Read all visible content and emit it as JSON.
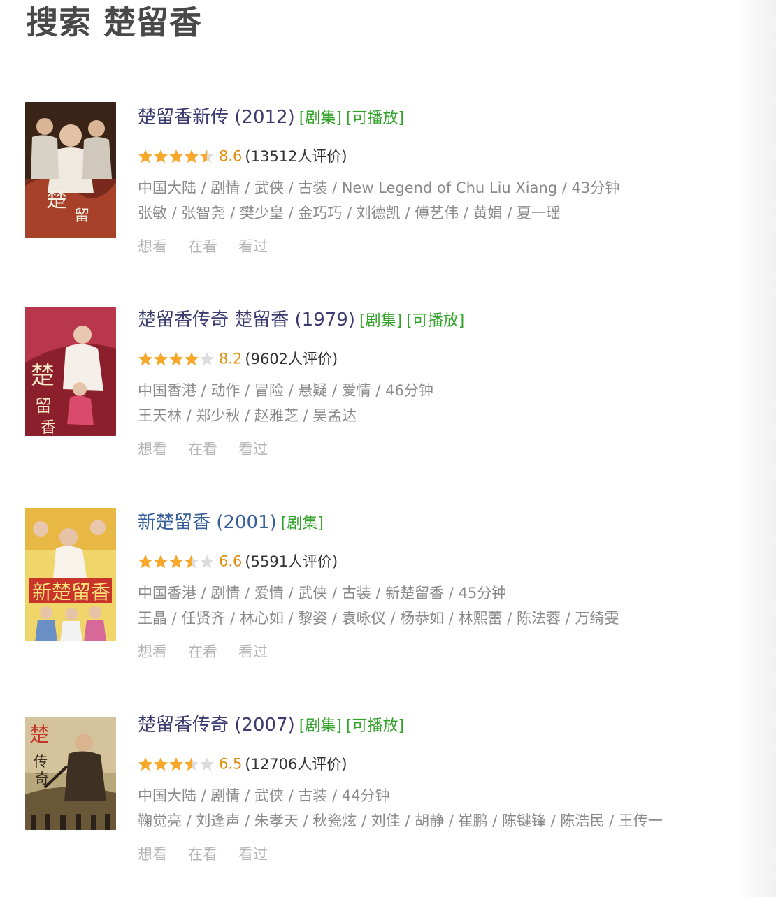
{
  "page_title": "搜索 楚留香",
  "colors": {
    "title": "#3b3b70",
    "tag": "#34a32b",
    "score": "#e09015",
    "star_on": "#f7a82a",
    "star_off": "#dcdcdc",
    "meta": "#8a8a8a"
  },
  "results": [
    {
      "title": "楚留香新传",
      "year": "(2012)",
      "tags": [
        "[剧集]",
        "[可播放]"
      ],
      "stars": 4.5,
      "score": "8.6",
      "votes": "(13512人评价)",
      "abstract": "中国大陆 / 剧情 / 武侠 / 古装 / New Legend of Chu Liu Xiang / 43分钟",
      "cast": "张敏 / 张智尧 / 樊少皇 / 金巧巧 / 刘德凯 / 傅艺伟 / 黄娟 / 夏一瑶",
      "actions": [
        "想看",
        "在看",
        "看过"
      ],
      "poster_icon": "poster-image"
    },
    {
      "title": "楚留香传奇 楚留香",
      "year": "(1979)",
      "tags": [
        "[剧集]",
        "[可播放]"
      ],
      "stars": 4,
      "score": "8.2",
      "votes": "(9602人评价)",
      "abstract": "中国香港 / 动作 / 冒险 / 悬疑 / 爱情 / 46分钟",
      "cast": "王天林 / 郑少秋 / 赵雅芝 / 吴孟达",
      "actions": [
        "想看",
        "在看",
        "看过"
      ],
      "poster_icon": "poster-image"
    },
    {
      "title": "新楚留香",
      "year": "(2001)",
      "tags": [
        "[剧集]"
      ],
      "stars": 3.5,
      "score": "6.6",
      "votes": "(5591人评价)",
      "abstract": "中国香港 / 剧情 / 爱情 / 武侠 / 古装 / 新楚留香 / 45分钟",
      "cast": "王晶 / 任贤齐 / 林心如 / 黎姿 / 袁咏仪 / 杨恭如 / 林熙蕾 / 陈法蓉 / 万绮雯",
      "actions": [
        "想看",
        "在看",
        "看过"
      ],
      "poster_icon": "poster-image"
    },
    {
      "title": "楚留香传奇",
      "year": "(2007)",
      "tags": [
        "[剧集]",
        "[可播放]"
      ],
      "stars": 3.5,
      "score": "6.5",
      "votes": "(12706人评价)",
      "abstract": "中国大陆 / 剧情 / 武侠 / 古装 / 44分钟",
      "cast": "鞠觉亮 / 刘逢声 / 朱孝天 / 秋瓷炫 / 刘佳 / 胡静 / 崔鹏 / 陈键锋 / 陈浩民 / 王传一",
      "actions": [
        "想看",
        "在看",
        "看过"
      ],
      "poster_icon": "poster-image"
    }
  ]
}
